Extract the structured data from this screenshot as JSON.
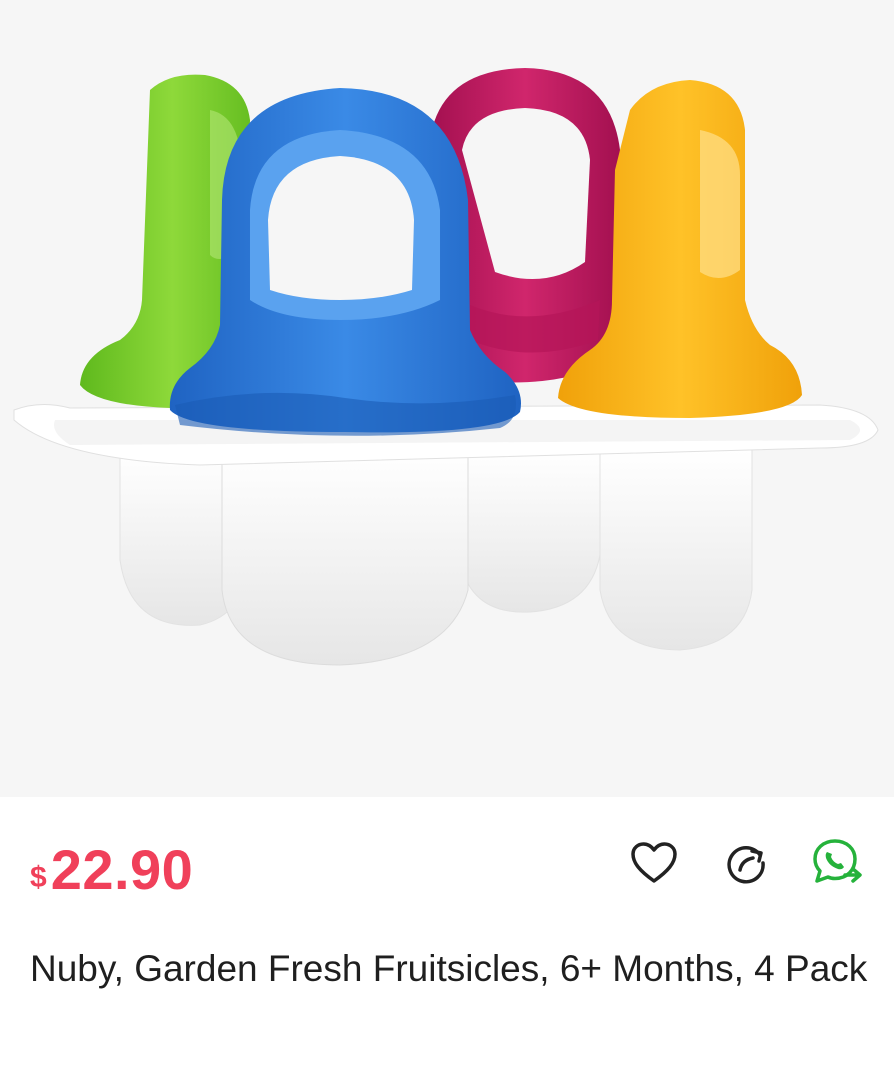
{
  "product": {
    "image_alt": "Nuby fruitsicle molds in green, blue, pink and yellow",
    "currency_symbol": "$",
    "price": "22.90",
    "title": "Nuby, Garden Fresh Fruitsicles, 6+ Months, 4 Pack"
  },
  "actions": {
    "wishlist_icon": "heart-icon",
    "share_icon": "share-icon",
    "whatsapp_icon": "whatsapp-icon"
  },
  "colors": {
    "price": "#f0405a",
    "whatsapp": "#25b23b",
    "molds": [
      "#7ccb2a",
      "#2f7fdb",
      "#c3195e",
      "#f7b212"
    ]
  }
}
